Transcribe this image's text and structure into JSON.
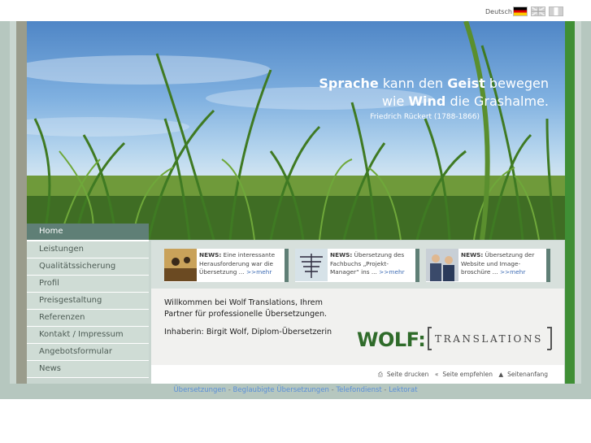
{
  "header": {
    "language_label": "Deutsch",
    "flags": [
      "flag-de-icon",
      "flag-uk-icon",
      "flag-it-icon"
    ]
  },
  "hero": {
    "quote_line1_bold1": "Sprache",
    "quote_line1_rest1": " kann den ",
    "quote_line1_bold2": "Geist",
    "quote_line1_rest2": " bewegen",
    "quote_line2_pre": "wie ",
    "quote_line2_bold": "Wind",
    "quote_line2_rest": " die Grashalme.",
    "author": "Friedrich Rückert (1788-1866)"
  },
  "nav": {
    "items": [
      {
        "label": "Home"
      },
      {
        "label": "Leistungen"
      },
      {
        "label": "Qualitätssicherung"
      },
      {
        "label": "Profil"
      },
      {
        "label": "Preisgestaltung"
      },
      {
        "label": "Referenzen"
      },
      {
        "label": "Kontakt / Impressum"
      },
      {
        "label": "Angebotsformular"
      },
      {
        "label": "News"
      }
    ]
  },
  "news": [
    {
      "tag": "NEWS:",
      "text": " Eine interessante Herausforderung war die Übersetzung ... ",
      "more": ">>mehr"
    },
    {
      "tag": "NEWS:",
      "text": " Übersetzung des Fachbuchs „Projekt-Manager“ ins ... ",
      "more": ">>mehr"
    },
    {
      "tag": "NEWS:",
      "text": " Übersetzung der Website und Image-broschüre ... ",
      "more": ">>mehr"
    }
  ],
  "main": {
    "welcome_line1": "Willkommen bei Wolf Translations, Ihrem",
    "welcome_line2": "Partner für professionelle Übersetzungen.",
    "owner": "Inhaberin: Birgit Wolf, Diplom-Übersetzerin"
  },
  "logo": {
    "wolf": "WOLF:",
    "translations": "TRANSLATIONS"
  },
  "tools": {
    "print": "Seite drucken",
    "recommend": "Seite empfehlen",
    "top": "Seitenanfang"
  },
  "footer": {
    "link1": "Übersetzungen",
    "link2": "Beglaubigte Übersetzungen",
    "link3": "Telefondienst",
    "link4": "Lektorat",
    "sep": " - "
  },
  "colors": {
    "nav_active": "#5f7f76",
    "brand_green": "#2f6b2a",
    "link_blue": "#5a8fd8"
  }
}
